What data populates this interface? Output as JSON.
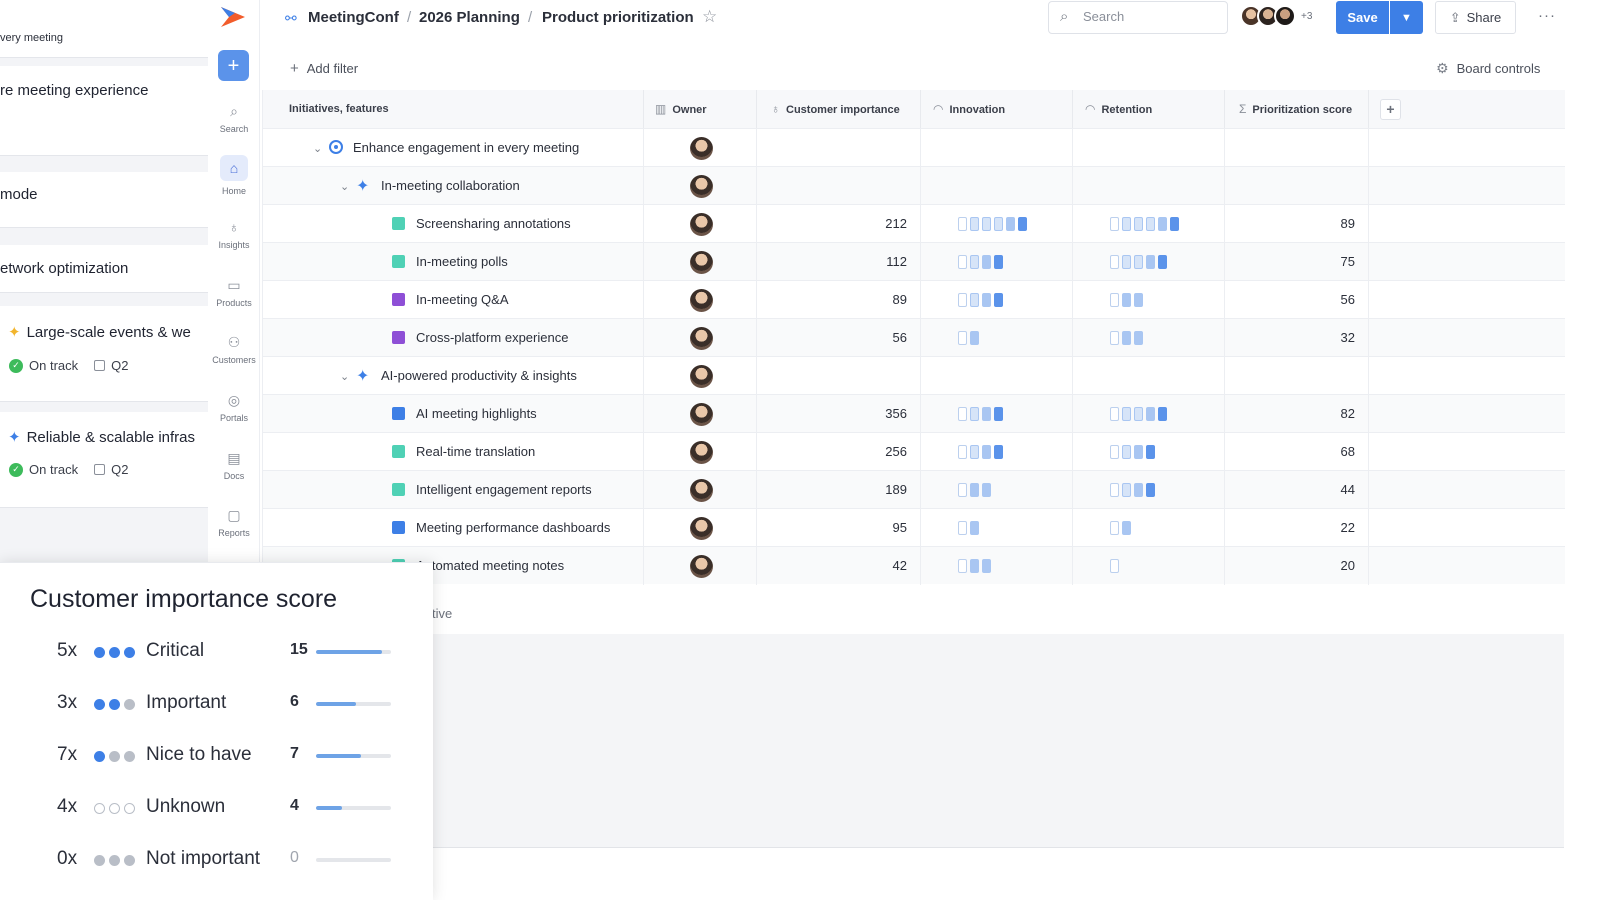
{
  "left_panel": {
    "item1": "very meeting",
    "item2": "re meeting experience",
    "item3": " mode",
    "item4": "etwork optimization",
    "item5": {
      "title": "Large-scale events & we",
      "status": "On track",
      "quarter": "Q2"
    },
    "item6": {
      "title": "Reliable & scalable infras",
      "status": "On track",
      "quarter": "Q2"
    }
  },
  "nav": {
    "items": [
      {
        "label": "Search",
        "icon": "search-icon"
      },
      {
        "label": "Home",
        "icon": "home-icon"
      },
      {
        "label": "Insights",
        "icon": "lightbulb-icon"
      },
      {
        "label": "Products",
        "icon": "box-icon"
      },
      {
        "label": "Customers",
        "icon": "people-icon"
      },
      {
        "label": "Portals",
        "icon": "compass-icon"
      },
      {
        "label": "Docs",
        "icon": "doc-icon"
      },
      {
        "label": "Reports",
        "icon": "monitor-icon"
      }
    ],
    "active": "Home"
  },
  "header": {
    "breadcrumb": [
      "MeetingConf",
      "2026 Planning",
      "Product prioritization"
    ],
    "search_placeholder": "Search",
    "extra_avatars": "+3",
    "save_label": "Save",
    "share_label": "Share"
  },
  "toolbar": {
    "add_filter": "Add filter",
    "board_controls": "Board controls"
  },
  "table": {
    "columns": [
      "Initiatives, features",
      "Owner",
      "Customer importance",
      "Innovation",
      "Retention",
      "Prioritization score"
    ],
    "rows": [
      {
        "kind": "initiative",
        "name": "Enhance engagement in every meeting",
        "importance": "",
        "innovation": 0,
        "retention": 0,
        "score": ""
      },
      {
        "kind": "group",
        "name": "In-meeting collaboration",
        "importance": "",
        "innovation": 0,
        "retention": 0,
        "score": ""
      },
      {
        "kind": "feature",
        "color": "#4fd1b5",
        "name": "Screensharing annotations",
        "importance": "212",
        "innovation": 6,
        "retention": 6,
        "score": "89"
      },
      {
        "kind": "feature",
        "color": "#4fd1b5",
        "name": "In-meeting polls",
        "importance": "112",
        "innovation": 4,
        "retention": 5,
        "score": "75"
      },
      {
        "kind": "feature",
        "color": "#8e4fd6",
        "name": "In-meeting Q&A",
        "importance": "89",
        "innovation": 4,
        "retention": 3,
        "score": "56"
      },
      {
        "kind": "feature",
        "color": "#8e4fd6",
        "name": "Cross-platform experience",
        "importance": "56",
        "innovation": 2,
        "retention": 3,
        "score": "32"
      },
      {
        "kind": "group",
        "name": "AI-powered productivity & insights",
        "importance": "",
        "innovation": 0,
        "retention": 0,
        "score": ""
      },
      {
        "kind": "feature",
        "color": "#3d7fe6",
        "name": "AI meeting highlights",
        "importance": "356",
        "innovation": 4,
        "retention": 5,
        "score": "82"
      },
      {
        "kind": "feature",
        "color": "#4fd1b5",
        "name": "Real-time translation",
        "importance": "256",
        "innovation": 4,
        "retention": 4,
        "score": "68"
      },
      {
        "kind": "feature",
        "color": "#4fd1b5",
        "name": "Intelligent engagement reports",
        "importance": "189",
        "innovation": 3,
        "retention": 4,
        "score": "44"
      },
      {
        "kind": "feature",
        "color": "#3d7fe6",
        "name": "Meeting performance dashboards",
        "importance": "95",
        "innovation": 2,
        "retention": 2,
        "score": "22"
      },
      {
        "kind": "feature",
        "color": "#4fd1b5",
        "name": "Automated meeting notes",
        "importance": "42",
        "innovation": 3,
        "retention": 1,
        "score": "20"
      }
    ],
    "add_row_partial": "tive"
  },
  "popover": {
    "title": "Customer importance score",
    "levels": [
      {
        "mult": "5x",
        "label": "Critical",
        "count": "15",
        "fill": 0.88,
        "dots": [
          "#3d7fe6",
          "#3d7fe6",
          "#3d7fe6"
        ]
      },
      {
        "mult": "3x",
        "label": "Important",
        "count": "6",
        "fill": 0.53,
        "dots": [
          "#3d7fe6",
          "#3d7fe6",
          "#b9bec7"
        ]
      },
      {
        "mult": "7x",
        "label": "Nice to have",
        "count": "7",
        "fill": 0.6,
        "dots": [
          "#3d7fe6",
          "#b9bec7",
          "#b9bec7"
        ]
      },
      {
        "mult": "4x",
        "label": "Unknown",
        "count": "4",
        "fill": 0.35,
        "dots": [
          "outline",
          "outline",
          "outline"
        ]
      },
      {
        "mult": "0x",
        "label": "Not important",
        "count": "0",
        "fill": 0,
        "dots": [
          "#b9bec7",
          "#b9bec7",
          "#b9bec7"
        ]
      }
    ]
  },
  "colors": {
    "accent": "#3d7fe6",
    "on_track": "#3dbb5b"
  }
}
